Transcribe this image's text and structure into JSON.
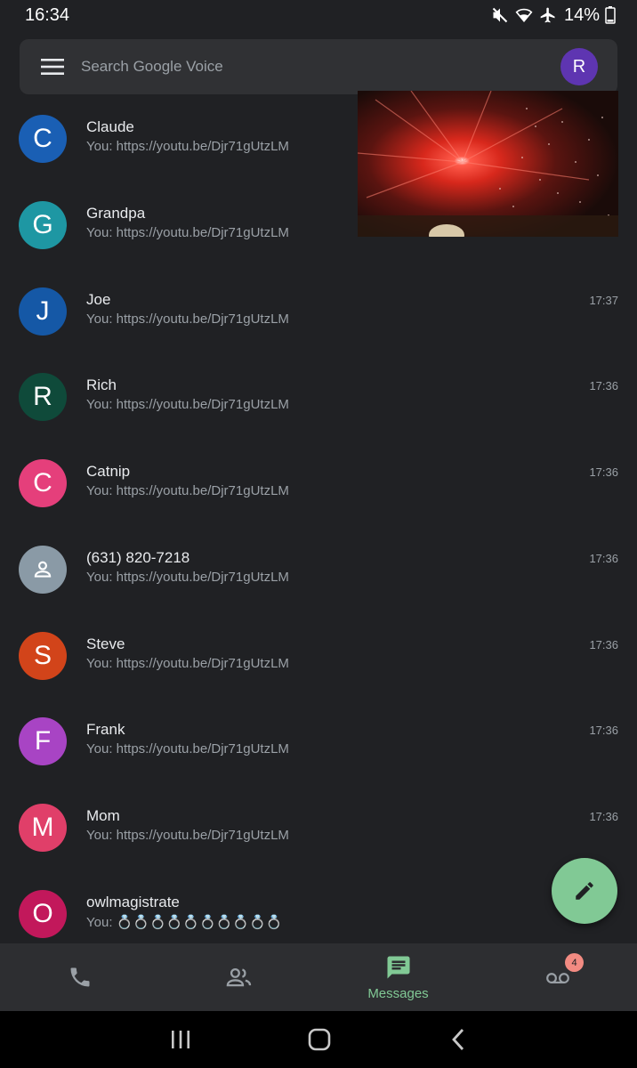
{
  "status_bar": {
    "time": "16:34",
    "battery": "14%"
  },
  "search": {
    "placeholder": "Search Google Voice",
    "account_initial": "R"
  },
  "conversations": [
    {
      "initial": "C",
      "name": "Claude",
      "snippet": "You: https://youtu.be/Djr71gUtzLM",
      "time": "",
      "color": "#1a5fb4"
    },
    {
      "initial": "G",
      "name": "Grandpa",
      "snippet": "You: https://youtu.be/Djr71gUtzLM",
      "time": "",
      "color": "#1e97a3"
    },
    {
      "initial": "J",
      "name": "Joe",
      "snippet": "You: https://youtu.be/Djr71gUtzLM",
      "time": "17:37",
      "color": "#1558a6"
    },
    {
      "initial": "R",
      "name": "Rich",
      "snippet": "You: https://youtu.be/Djr71gUtzLM",
      "time": "17:36",
      "color": "#0f4a3a"
    },
    {
      "initial": "C",
      "name": "Catnip",
      "snippet": "You: https://youtu.be/Djr71gUtzLM",
      "time": "17:36",
      "color": "#e53f7b"
    },
    {
      "initial": "",
      "name": "(631) 820‑7218",
      "snippet": "You: https://youtu.be/Djr71gUtzLM",
      "time": "17:36",
      "color": "#8a9aa6",
      "icon": "person-icon"
    },
    {
      "initial": "S",
      "name": "Steve",
      "snippet": "You: https://youtu.be/Djr71gUtzLM",
      "time": "17:36",
      "color": "#d2441a"
    },
    {
      "initial": "F",
      "name": "Frank",
      "snippet": "You: https://youtu.be/Djr71gUtzLM",
      "time": "17:36",
      "color": "#a844c4"
    },
    {
      "initial": "M",
      "name": "Mom",
      "snippet": "You: https://youtu.be/Djr71gUtzLM",
      "time": "17:36",
      "color": "#e03f69"
    },
    {
      "initial": "O",
      "name": "owlmagistrate",
      "snippet": "You: 💍💍💍💍💍💍💍💍💍💍",
      "time": "",
      "color": "#c2185b"
    }
  ],
  "bottom_nav": {
    "calls_icon": "phone-icon",
    "contacts_icon": "contacts-icon",
    "messages_label": "Messages",
    "voicemail_badge": "4",
    "active_color": "#81c995"
  },
  "fab": {
    "icon": "pencil-icon",
    "color": "#81c995"
  }
}
